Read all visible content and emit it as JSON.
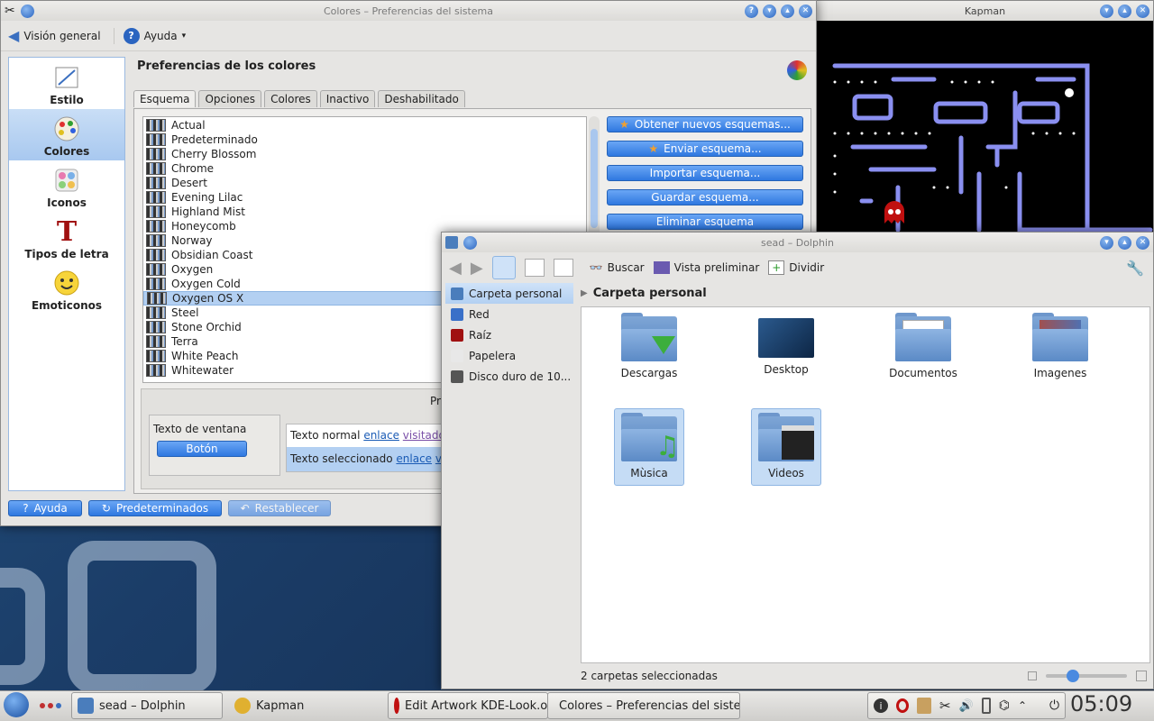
{
  "colors_window": {
    "title": "Colores – Preferencias del sistema",
    "toolbar": {
      "overview": "Visión general",
      "help": "Ayuda"
    },
    "heading": "Preferencias de los colores",
    "categories": [
      {
        "label": "Estilo"
      },
      {
        "label": "Colores"
      },
      {
        "label": "Iconos"
      },
      {
        "label": "Tipos de letra"
      },
      {
        "label": "Emoticonos"
      }
    ],
    "tabs": [
      "Esquema",
      "Opciones",
      "Colores",
      "Inactivo",
      "Deshabilitado"
    ],
    "schemes": [
      "Actual",
      "Predeterminado",
      "Cherry Blossom",
      "Chrome",
      "Desert",
      "Evening Lilac",
      "Highland Mist",
      "Honeycomb",
      "Norway",
      "Obsidian Coast",
      "Oxygen",
      "Oxygen Cold",
      "Oxygen OS X",
      "Steel",
      "Stone Orchid",
      "Terra",
      "White Peach",
      "Whitewater"
    ],
    "selected_scheme": "Oxygen OS X",
    "actions": [
      "Obtener nuevos esquemas...",
      "Enviar esquema...",
      "Importar esquema...",
      "Guardar esquema...",
      "Eliminar esquema"
    ],
    "preview": {
      "label_partial": "Pr",
      "window_text": "Texto de ventana",
      "button": "Botón",
      "normal_text": "Texto normal",
      "link": "enlace",
      "visited": "visitado",
      "selected_text": "Texto seleccionado",
      "selected_visited": "v"
    },
    "footer": {
      "help": "Ayuda",
      "defaults": "Predeterminados",
      "reset": "Restablecer"
    }
  },
  "kapman": {
    "title": "Kapman"
  },
  "dolphin": {
    "title": "sead – Dolphin",
    "toolbar": {
      "search": "Buscar",
      "preview": "Vista preliminar",
      "split": "Dividir"
    },
    "places": [
      "Carpeta personal",
      "Red",
      "Raíz",
      "Papelera",
      "Disco duro de 10..."
    ],
    "breadcrumb": "Carpeta personal",
    "folders": [
      "Descargas",
      "Desktop",
      "Documentos",
      "Imagenes",
      "Mùsica",
      "Videos"
    ],
    "status": "2 carpetas seleccionadas",
    "zoom": 0.3
  },
  "taskbar": {
    "tasks": [
      "sead – Dolphin",
      "Kapman",
      "Edit Artwork KDE-Look.org",
      "Colores – Preferencias del siste"
    ],
    "clock": "05:09"
  }
}
